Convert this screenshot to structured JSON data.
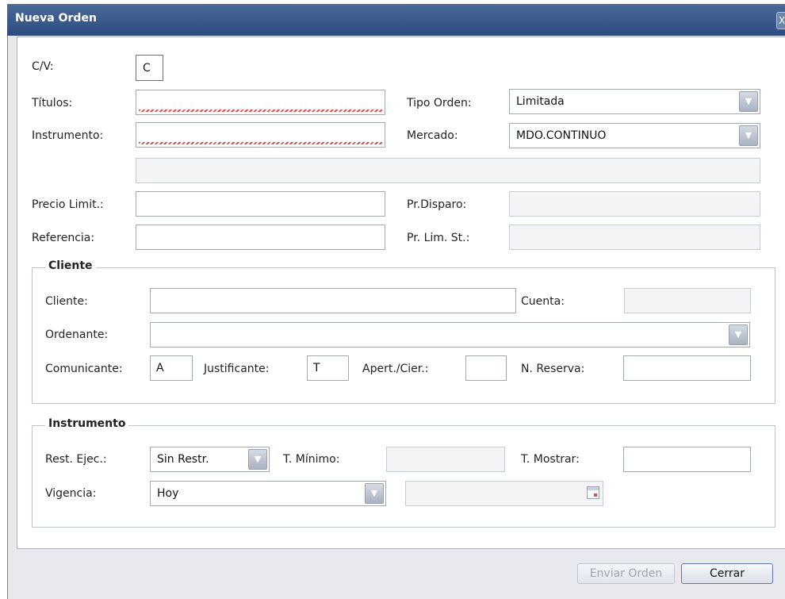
{
  "window": {
    "title": "Nueva Orden",
    "close_label": "X"
  },
  "top": {
    "cv_label": "C/V:",
    "cv_value": "C",
    "titulos_label": "Títulos:",
    "titulos_value": "",
    "instrumento_label": "Instrumento:",
    "instrumento_value": "",
    "tipo_orden_label": "Tipo Orden:",
    "tipo_orden_value": "Limitada",
    "mercado_label": "Mercado:",
    "mercado_value": "MDO.CONTINUO",
    "descripcion_value": "",
    "precio_limit_label": "Precio Limit.:",
    "precio_limit_value": "",
    "referencia_label": "Referencia:",
    "referencia_value": "",
    "pr_disparo_label": "Pr.Disparo:",
    "pr_disparo_value": "",
    "pr_lim_st_label": "Pr. Lim. St.:",
    "pr_lim_st_value": ""
  },
  "cliente_group": {
    "legend": "Cliente",
    "cliente_label": "Cliente:",
    "cliente_value": "",
    "cuenta_label": "Cuenta:",
    "cuenta_value": "",
    "ordenante_label": "Ordenante:",
    "ordenante_value": "",
    "comunicante_label": "Comunicante:",
    "comunicante_value": "A",
    "justificante_label": "Justificante:",
    "justificante_value": "T",
    "apert_cier_label": "Apert./Cier.:",
    "apert_cier_value": "",
    "n_reserva_label": "N. Reserva:",
    "n_reserva_value": ""
  },
  "instrumento_group": {
    "legend": "Instrumento",
    "rest_ejec_label": "Rest. Ejec.:",
    "rest_ejec_value": "Sin Restr.",
    "t_minimo_label": "T. Mínimo:",
    "t_minimo_value": "",
    "t_mostrar_label": "T. Mostrar:",
    "t_mostrar_value": "",
    "vigencia_label": "Vigencia:",
    "vigencia_value": "Hoy",
    "fecha_value": ""
  },
  "footer": {
    "send_label": "Enviar Orden",
    "close_label": "Cerrar"
  },
  "icons": {
    "dropdown": "chevron-down-icon",
    "calendar": "calendar-icon",
    "close": "close-icon"
  },
  "colors": {
    "titlebar": "#2c4c80",
    "error_underline": "#e14b4b",
    "focus_border": "#3d77c7"
  }
}
